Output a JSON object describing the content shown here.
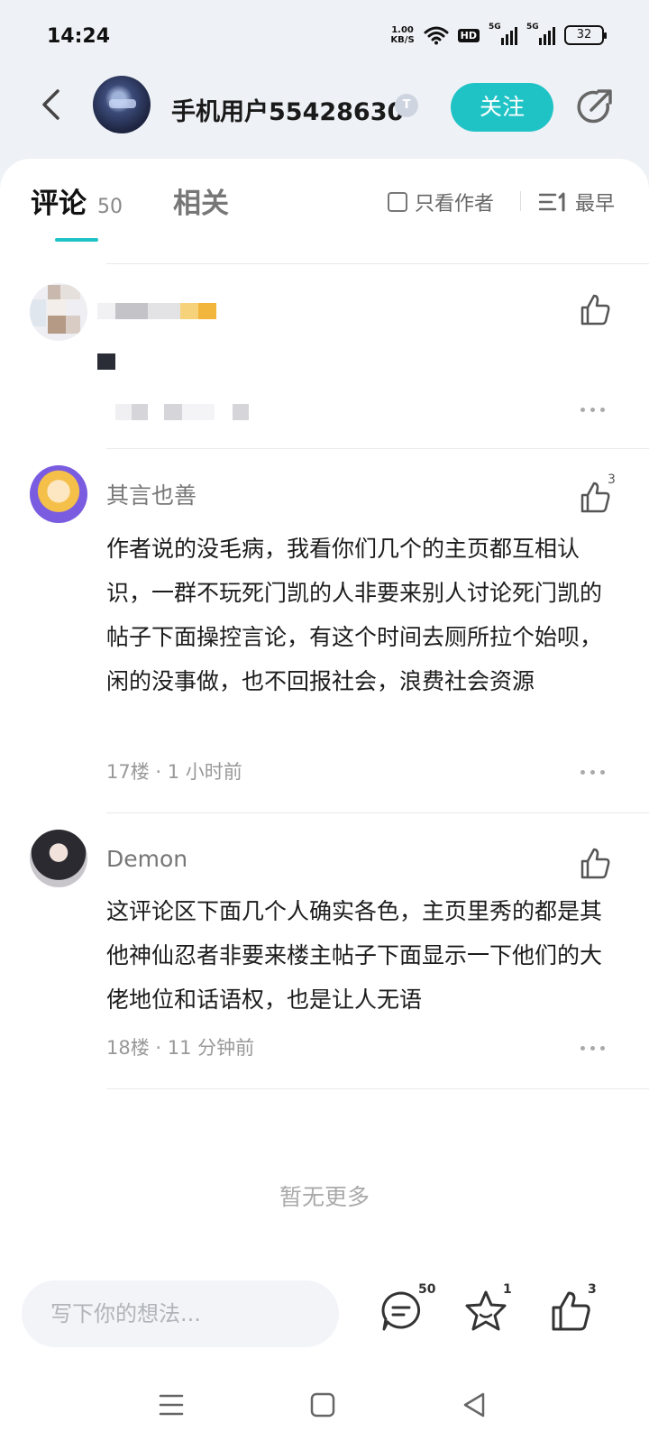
{
  "status_bar": {
    "time": "14:24",
    "net_speed_value": "1.00",
    "net_speed_unit": "KB/S",
    "hd_label": "HD",
    "signal_1_label": "5G",
    "signal_2_label": "5G",
    "battery": "32"
  },
  "header": {
    "username": "手机用户55428630",
    "level_badge": "T",
    "follow_label": "关注"
  },
  "tabs": {
    "comments_label": "评论",
    "comments_count": "50",
    "related_label": "相关",
    "author_only_label": "只看作者",
    "sort_label": "最早"
  },
  "comments": [
    {
      "name": "其言也善",
      "body": "作者说的没毛病，我看你们几个的主页都互相认识，一群不玩死门凯的人非要来别人讨论死门凯的帖子下面操控言论，有这个时间去厕所拉个始呗，闲的没事做，也不回报社会，浪费社会资源",
      "meta": "17楼 · 1 小时前",
      "likes": "3"
    },
    {
      "name": "Demon",
      "body": "这评论区下面几个人确实各色，主页里秀的都是其他神仙忍者非要来楼主帖子下面显示一下他们的大佬地位和话语权，也是让人无语",
      "meta": "18楼 · 11 分钟前",
      "likes": ""
    }
  ],
  "no_more_label": "暂无更多",
  "bottom_bar": {
    "input_placeholder": "写下你的想法...",
    "comment_count": "50",
    "favorite_count": "1",
    "like_count": "3"
  },
  "colors": {
    "accent": "#1fc3c6",
    "page_bg": "#eef1f5"
  }
}
